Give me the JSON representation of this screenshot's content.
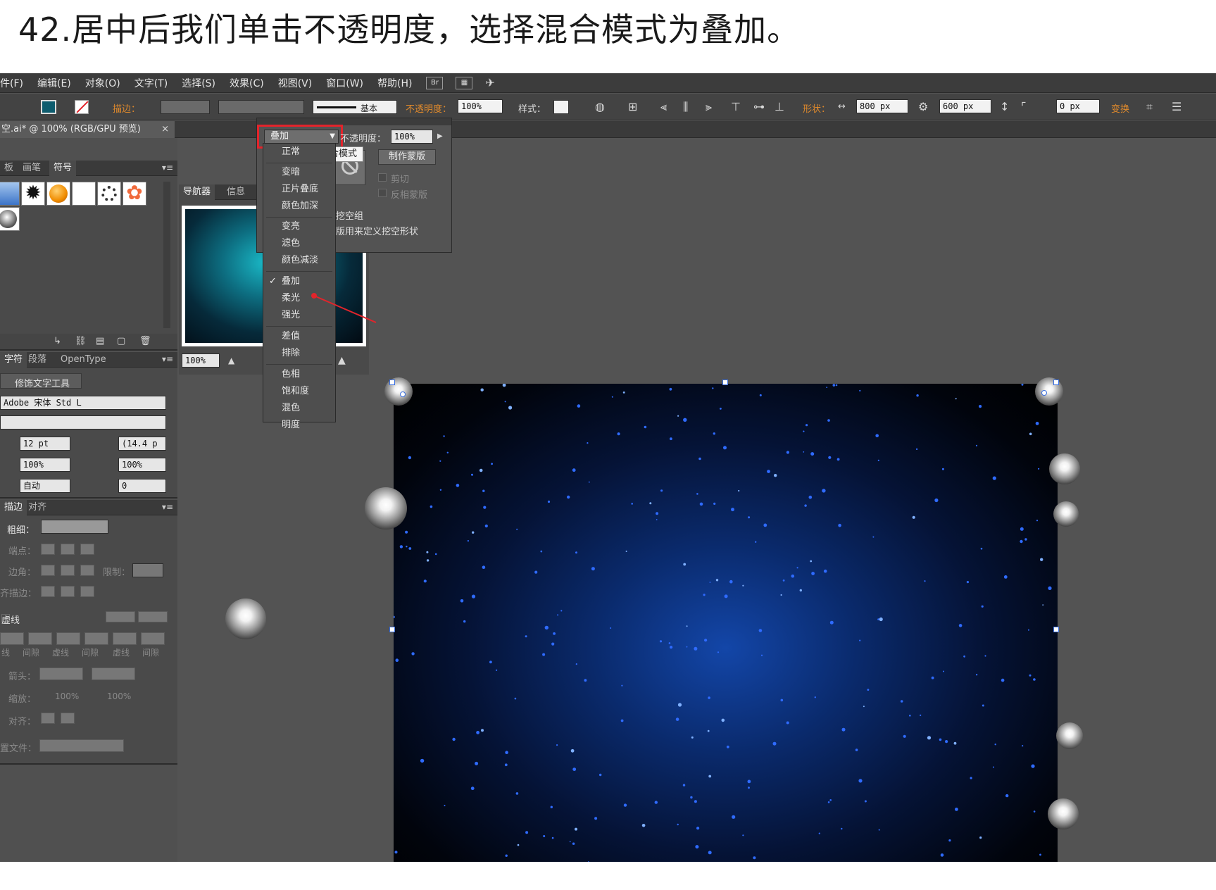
{
  "caption": "42.居中后我们单击不透明度，选择混合模式为叠加。",
  "menubar": {
    "items": [
      "件(F)",
      "编辑(E)",
      "对象(O)",
      "文字(T)",
      "选择(S)",
      "效果(C)",
      "视图(V)",
      "窗口(W)",
      "帮助(H)"
    ],
    "bridge_label": "Br"
  },
  "controlbar": {
    "stroke_label": "描边：",
    "stroke_style": "基本",
    "opacity_label": "不透明度：",
    "opacity_value": "100%",
    "style_label": "样式：",
    "shape_label": "形状：",
    "width_value": "800 px",
    "height_value": "600 px",
    "corner_value": "0 px",
    "transform_label": "变换"
  },
  "document": {
    "tab_title": "空.ai* @ 100% (RGB/GPU 预览)",
    "close": "×"
  },
  "symbols_panel": {
    "tabs": [
      "板",
      "画笔",
      "符号"
    ]
  },
  "navigator_panel": {
    "tabs": [
      "导航器",
      "信息"
    ],
    "zoom": "100%"
  },
  "character_panel": {
    "tabs": [
      "字符",
      "段落",
      "OpenType"
    ],
    "touch_tool": "修饰文字工具",
    "font_family": "Adobe 宋体 Std L",
    "font_size": "12 pt",
    "leading": "(14.4 p",
    "vscale": "100%",
    "hscale": "100%",
    "kerning": "自动",
    "tracking": "0"
  },
  "stroke_panel": {
    "tabs": [
      "描边",
      "对齐"
    ],
    "weight_label": "粗细：",
    "cap_label": "端点：",
    "corner_label": "边角：",
    "limit_label": "限制：",
    "align_label": "齐描边：",
    "dashed_label": "虚线",
    "dash_labels": [
      "线",
      "间隙",
      "虚线",
      "间隙",
      "虚线",
      "间隙"
    ],
    "arrow_label": "箭头：",
    "scale_label": "缩放：",
    "scale_a": "100%",
    "scale_b": "100%",
    "align2_label": "对齐：",
    "profile_label": "置文件："
  },
  "transparency_panel": {
    "blend_mode": "叠加",
    "opacity_label": "不透明度：",
    "opacity_value": "100%",
    "tooltip": "混合模式",
    "make_mask": "制作蒙版",
    "clip": "剪切",
    "invert_mask": "反相蒙版",
    "knockout_group": "挖空组",
    "opacity_knockout": "版用来定义挖空形状"
  },
  "blend_modes": {
    "selected": "叠加",
    "groups": [
      [
        "正常"
      ],
      [
        "变暗",
        "正片叠底",
        "颜色加深"
      ],
      [
        "变亮",
        "滤色",
        "颜色减淡"
      ],
      [
        "叠加",
        "柔光",
        "强光"
      ],
      [
        "差值",
        "排除"
      ],
      [
        "色相",
        "饱和度",
        "混色",
        "明度"
      ]
    ]
  },
  "colors": {
    "ui_bg": "#535353",
    "highlight": "#e3242b",
    "accent_orange": "#e08a2c"
  }
}
